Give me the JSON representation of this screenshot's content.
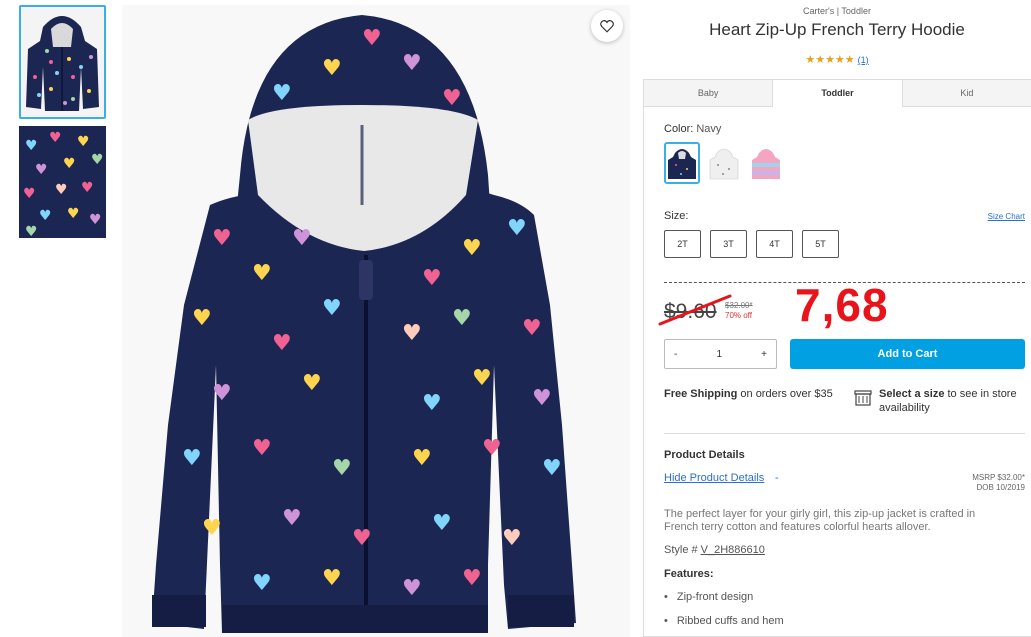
{
  "product": {
    "brand": "Carter's | Toddler",
    "title": "Heart Zip-Up French Terry Hoodie",
    "stars": "★★★★★",
    "review_count": "(1)"
  },
  "tabs": [
    {
      "label": "Baby"
    },
    {
      "label": "Toddler"
    },
    {
      "label": "Kid"
    }
  ],
  "color": {
    "label": "Color:",
    "value": "Navy"
  },
  "size": {
    "label": "Size:",
    "chart_link": "Size Chart",
    "options": [
      "2T",
      "3T",
      "4T",
      "5T"
    ]
  },
  "price": {
    "sale": "$9.60",
    "original": "$32.00*",
    "discount": "70% off",
    "overlay_annotation": "7,68"
  },
  "cart": {
    "qty_minus": "-",
    "qty_value": "1",
    "qty_plus": "+",
    "add_label": "Add to Cart"
  },
  "shipping": {
    "bold": "Free Shipping",
    "text": " on orders over $35"
  },
  "store": {
    "bold": "Select a size",
    "text": " to see in store availability"
  },
  "details": {
    "title": "Product Details",
    "hide_link": "Hide Product Details",
    "hide_dash": "-",
    "msrp": "MSRP $32.00*",
    "dob": "DOB 10/2019",
    "description": "The perfect layer for your girly girl, this zip-up jacket is crafted in French terry cotton and features colorful hearts allover.",
    "style_label": "Style #",
    "style_value": "V_2H886610",
    "features_title": "Features:",
    "features": [
      "Zip-front design",
      "Ribbed cuffs and hem"
    ]
  },
  "colors": {
    "accent": "#00a0e3",
    "selected_border": "#3ab0e2",
    "annotation_red": "#e8141a",
    "navy": "#1c2653"
  }
}
